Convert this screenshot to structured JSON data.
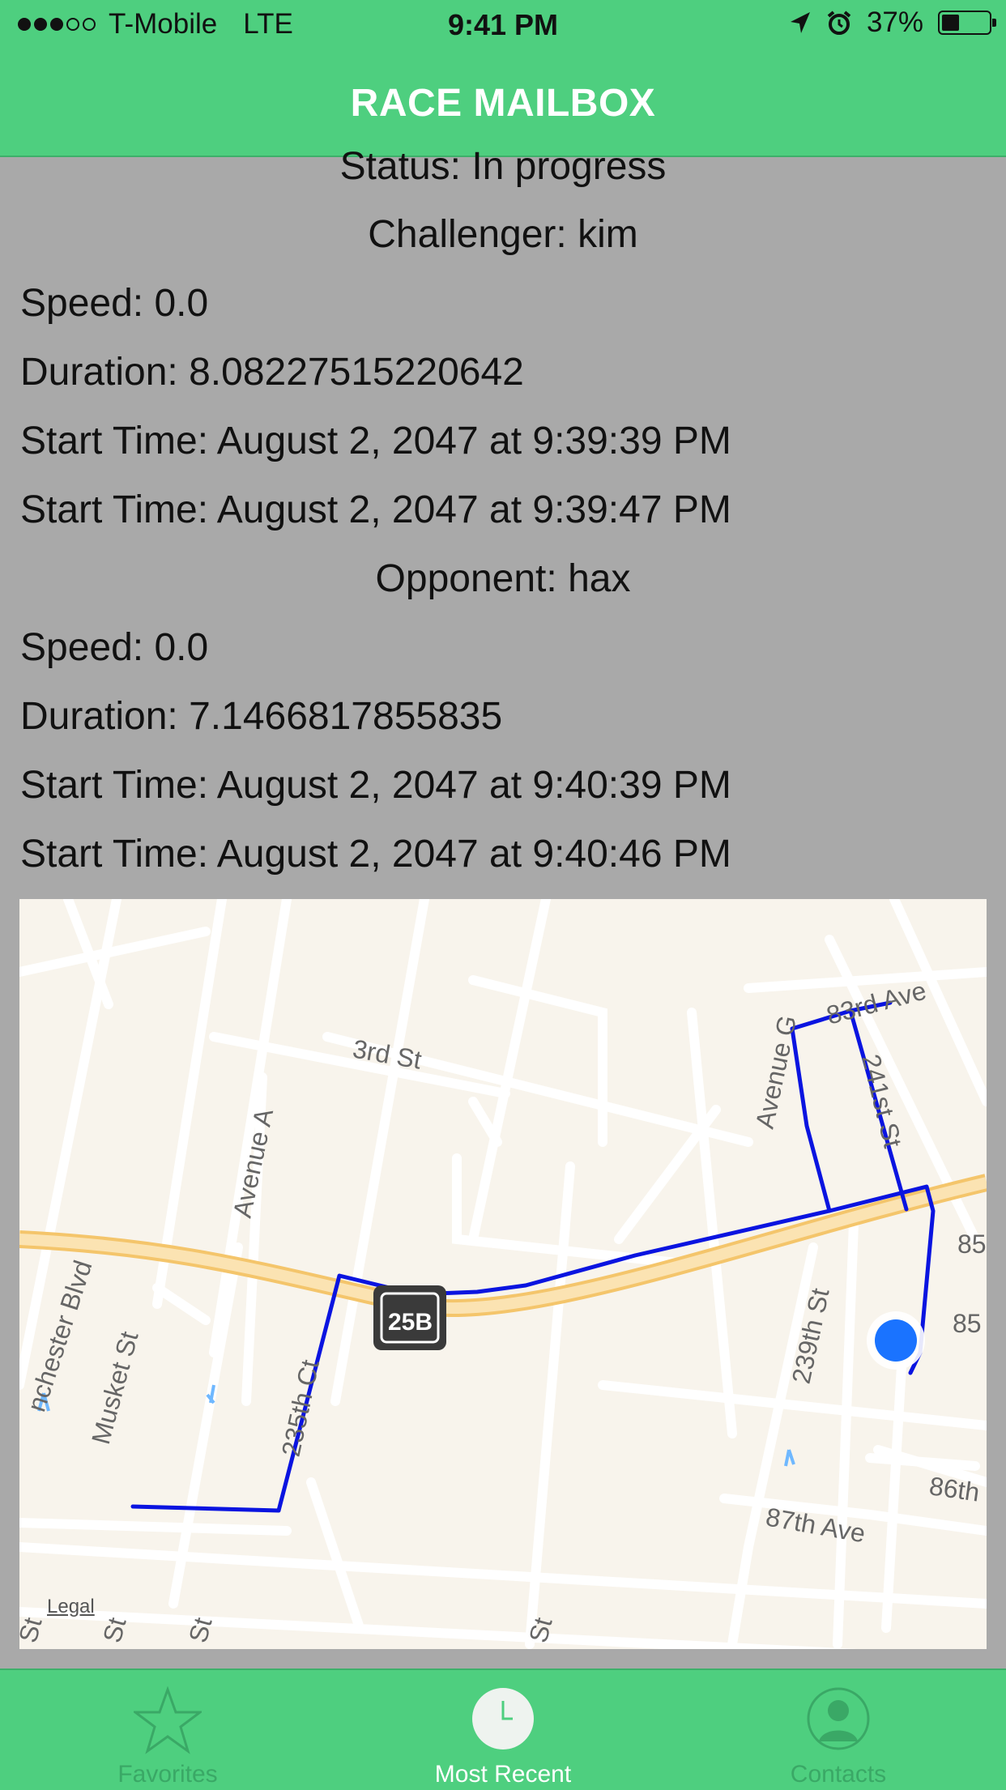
{
  "status_bar": {
    "carrier": "T-Mobile",
    "network": "LTE",
    "time": "9:41 PM",
    "battery": "37%",
    "battery_level": 0.37
  },
  "nav": {
    "title": "RACE MAILBOX"
  },
  "race": {
    "status": "Status: In progress",
    "challenger": {
      "heading": "Challenger: kim",
      "speed": "Speed: 0.0",
      "duration": "Duration: 8.08227515220642",
      "start_time": "Start Time: August 2, 2047 at 9:39:39 PM",
      "start_time_2": "Start Time: August 2, 2047 at 9:39:47 PM"
    },
    "opponent": {
      "heading": "Opponent: hax",
      "speed": "Speed: 0.0",
      "duration": "Duration: 7.1466817855835",
      "start_time": "Start Time: August 2, 2047 at 9:40:39 PM",
      "start_time_2": "Start Time: August 2, 2047 at 9:40:46 PM"
    }
  },
  "map": {
    "labels": {
      "third_st": "3rd St",
      "avenue_a": "Avenue A",
      "avenue_g": "Avenue G",
      "eighty_third": "83rd Ave",
      "two_forty_first": "241st St",
      "route": "25B",
      "eighty_five_a": "85",
      "eighty_five_b": "85",
      "two_thirty_ninth": "239th St",
      "two_thirty_fifth": "235th Ct",
      "musket": "Musket St",
      "winchester": "nchester Blvd",
      "eighty_sixth": "86th",
      "eighty_seventh": "87th Ave",
      "st_1": "St",
      "st_2": "St",
      "st_3": "St",
      "st_4": "St"
    },
    "legal": "Legal",
    "route_color": "#0a14e0",
    "location_color": "#1a73ff"
  },
  "tabs": [
    {
      "label": "Favorites",
      "icon": "star-icon"
    },
    {
      "label": "Most Recent",
      "icon": "clock-icon"
    },
    {
      "label": "Contacts",
      "icon": "person-icon"
    }
  ]
}
